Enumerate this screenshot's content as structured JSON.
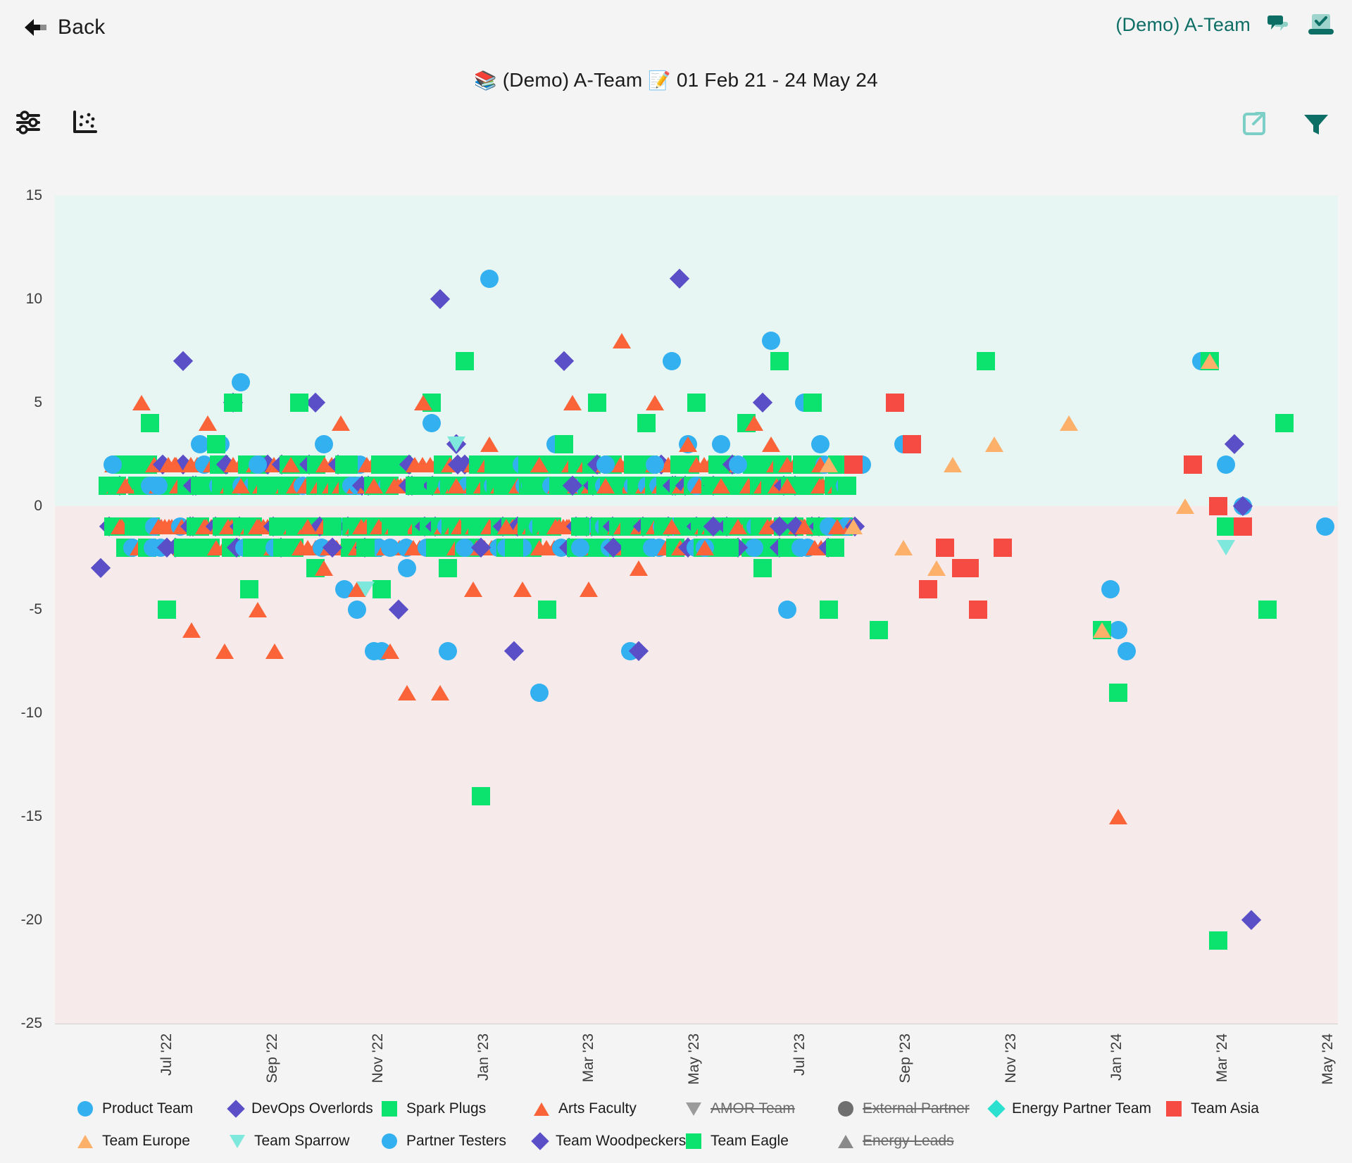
{
  "header": {
    "back_label": "Back",
    "back_icon": "arrow-left-icon",
    "account_label": "(Demo) A-Team",
    "chat_icon": "chat-bubbles-icon",
    "check_icon": "laptop-check-icon"
  },
  "page_title": {
    "books_emoji": "📚",
    "board_label": "(Demo) A-Team",
    "calendar_emoji": "📝",
    "date_range": "01 Feb 21 - 24 May 24"
  },
  "toolbar": {
    "settings_icon": "sliders-icon",
    "chart_icon": "scatter-plot-icon",
    "export_icon": "external-link-icon",
    "filter_icon": "funnel-filter-icon"
  },
  "colors": {
    "teal_dark": "#0d6e66",
    "teal_light": "#7ccfc6",
    "band_positive": "#e8f6f3",
    "band_negative": "#f7eaea",
    "page_bg": "#f4f4f4"
  },
  "chart_data": {
    "type": "scatter",
    "title": "(Demo) A-Team 01 Feb 21 - 24 May 24",
    "xlabel": "",
    "ylabel": "",
    "grid": false,
    "legend_position": "bottom",
    "ylim": [
      -25,
      15
    ],
    "yticks": [
      15,
      10,
      5,
      0,
      -5,
      -10,
      -15,
      -20,
      -25
    ],
    "xticks": [
      "Jul '22",
      "Sep '22",
      "Nov '22",
      "Jan '23",
      "Mar '23",
      "May '23",
      "Jul '23",
      "Sep '23",
      "Nov '23",
      "Jan '24",
      "Mar '24",
      "May '24"
    ],
    "xlim_months": [
      "2022-05-20",
      "2024-05-24"
    ],
    "bands": [
      {
        "from": 0,
        "to": 15,
        "color": "#e8f6f3"
      },
      {
        "from": -25,
        "to": 0,
        "color": "#f7eaea"
      }
    ],
    "series": [
      {
        "name": "Product Team",
        "marker": "circle",
        "color": "#32b0f0",
        "visible": true,
        "points": [
          [
            0.5,
            2
          ],
          [
            1.6,
            1
          ],
          [
            2.6,
            3
          ],
          [
            3.1,
            3
          ],
          [
            3.6,
            6
          ],
          [
            4.0,
            2
          ],
          [
            4.4,
            -2
          ],
          [
            4.6,
            -2
          ],
          [
            5.6,
            3
          ],
          [
            6.1,
            -4
          ],
          [
            6.4,
            -5
          ],
          [
            6.8,
            -7
          ],
          [
            7.0,
            -7
          ],
          [
            7.2,
            -2
          ],
          [
            7.6,
            -3
          ],
          [
            8.2,
            4
          ],
          [
            8.6,
            -7
          ],
          [
            9.0,
            -2
          ],
          [
            9.6,
            11
          ],
          [
            10.0,
            -2
          ],
          [
            10.4,
            -2
          ],
          [
            10.8,
            -9
          ],
          [
            11.2,
            3
          ],
          [
            11.8,
            -2
          ],
          [
            12.4,
            2
          ],
          [
            13.0,
            -7
          ],
          [
            13.6,
            2
          ],
          [
            14.0,
            7
          ],
          [
            14.4,
            3
          ],
          [
            14.8,
            -2
          ],
          [
            15.2,
            3
          ],
          [
            15.6,
            2
          ],
          [
            16.0,
            -2
          ],
          [
            16.4,
            8
          ],
          [
            16.8,
            -5
          ],
          [
            17.2,
            5
          ],
          [
            17.6,
            3
          ],
          [
            17.8,
            -1
          ],
          [
            18.6,
            2
          ],
          [
            19.6,
            3
          ],
          [
            24.6,
            -4
          ],
          [
            24.8,
            -6
          ],
          [
            25.0,
            -7
          ],
          [
            26.8,
            7
          ],
          [
            27.4,
            2
          ],
          [
            27.8,
            0
          ],
          [
            29.8,
            -1
          ]
        ]
      },
      {
        "name": "DevOps Overlords",
        "marker": "diamond",
        "color": "#5b4fc8",
        "visible": true,
        "points": [
          [
            0.2,
            -3
          ],
          [
            2.2,
            7
          ],
          [
            3.4,
            5
          ],
          [
            5.4,
            5
          ],
          [
            5.8,
            -2
          ],
          [
            7.4,
            -5
          ],
          [
            8.4,
            10
          ],
          [
            8.8,
            3
          ],
          [
            9.4,
            -2
          ],
          [
            10.2,
            -7
          ],
          [
            11.4,
            7
          ],
          [
            11.6,
            1
          ],
          [
            12.6,
            -2
          ],
          [
            13.2,
            -7
          ],
          [
            14.2,
            11
          ],
          [
            15.0,
            -1
          ],
          [
            15.6,
            -2
          ],
          [
            16.2,
            5
          ],
          [
            16.6,
            -1
          ],
          [
            17.0,
            -1
          ],
          [
            27.6,
            3
          ],
          [
            27.8,
            0
          ],
          [
            28.0,
            -20
          ]
        ]
      },
      {
        "name": "Spark Plugs",
        "marker": "square",
        "color": "#0ce36f",
        "visible": true,
        "points": [
          [
            0.6,
            1
          ],
          [
            1.0,
            -1
          ],
          [
            1.4,
            4
          ],
          [
            1.8,
            -5
          ],
          [
            2.2,
            -2
          ],
          [
            2.6,
            1
          ],
          [
            3.0,
            3
          ],
          [
            3.4,
            5
          ],
          [
            3.8,
            -4
          ],
          [
            4.2,
            1
          ],
          [
            4.6,
            -2
          ],
          [
            5.0,
            5
          ],
          [
            5.4,
            -3
          ],
          [
            5.8,
            -1
          ],
          [
            6.2,
            2
          ],
          [
            6.6,
            -2
          ],
          [
            7.0,
            -4
          ],
          [
            7.4,
            -1
          ],
          [
            7.8,
            1
          ],
          [
            8.2,
            5
          ],
          [
            8.6,
            -3
          ],
          [
            9.0,
            7
          ],
          [
            9.4,
            -14
          ],
          [
            9.8,
            2
          ],
          [
            10.2,
            -2
          ],
          [
            10.6,
            1
          ],
          [
            11.0,
            -5
          ],
          [
            11.4,
            3
          ],
          [
            11.8,
            -1
          ],
          [
            12.2,
            5
          ],
          [
            12.6,
            1
          ],
          [
            13.0,
            -2
          ],
          [
            13.4,
            4
          ],
          [
            13.8,
            -1
          ],
          [
            14.2,
            2
          ],
          [
            14.6,
            5
          ],
          [
            15.0,
            1
          ],
          [
            15.4,
            -2
          ],
          [
            15.8,
            4
          ],
          [
            16.2,
            -3
          ],
          [
            16.6,
            7
          ],
          [
            17.0,
            1
          ],
          [
            17.4,
            5
          ],
          [
            17.8,
            -5
          ],
          [
            18.2,
            2
          ],
          [
            19.0,
            -6
          ],
          [
            21.6,
            7
          ],
          [
            24.4,
            -6
          ],
          [
            24.8,
            -9
          ],
          [
            27.0,
            7
          ],
          [
            27.4,
            -1
          ],
          [
            28.4,
            -5
          ],
          [
            28.8,
            4
          ],
          [
            27.2,
            -21
          ]
        ]
      },
      {
        "name": "Arts Faculty",
        "marker": "triangle",
        "color": "#fa6438",
        "visible": true,
        "points": [
          [
            0.8,
            1
          ],
          [
            1.2,
            5
          ],
          [
            1.6,
            -1
          ],
          [
            2.0,
            2
          ],
          [
            2.4,
            -6
          ],
          [
            2.8,
            4
          ],
          [
            3.2,
            -7
          ],
          [
            3.6,
            1
          ],
          [
            4.0,
            -5
          ],
          [
            4.4,
            -7
          ],
          [
            4.8,
            2
          ],
          [
            5.2,
            -1
          ],
          [
            5.6,
            -3
          ],
          [
            6.0,
            4
          ],
          [
            6.4,
            -4
          ],
          [
            6.8,
            1
          ],
          [
            7.2,
            -7
          ],
          [
            7.6,
            -9
          ],
          [
            8.0,
            5
          ],
          [
            8.4,
            -9
          ],
          [
            8.8,
            1
          ],
          [
            9.2,
            -4
          ],
          [
            9.6,
            3
          ],
          [
            10.0,
            -1
          ],
          [
            10.4,
            -4
          ],
          [
            10.8,
            2
          ],
          [
            11.2,
            -1
          ],
          [
            11.6,
            5
          ],
          [
            12.0,
            -4
          ],
          [
            12.4,
            1
          ],
          [
            12.8,
            8
          ],
          [
            13.2,
            -3
          ],
          [
            13.6,
            5
          ],
          [
            14.0,
            -1
          ],
          [
            14.4,
            3
          ],
          [
            14.8,
            -2
          ],
          [
            15.2,
            1
          ],
          [
            15.6,
            -1
          ],
          [
            16.0,
            4
          ],
          [
            16.4,
            3
          ],
          [
            16.8,
            1
          ],
          [
            17.2,
            -1
          ],
          [
            17.6,
            2
          ],
          [
            18.0,
            -1
          ],
          [
            24.8,
            -15
          ]
        ]
      },
      {
        "name": "AMOR Team",
        "marker": "triangle-down",
        "color": "#9b9b9b",
        "visible": false,
        "points": []
      },
      {
        "name": "External Partner",
        "marker": "circle",
        "color": "#6f6f6f",
        "visible": false,
        "points": []
      },
      {
        "name": "Energy Partner Team",
        "marker": "diamond",
        "color": "#2ce0cf",
        "visible": true,
        "points": []
      },
      {
        "name": "Team Asia",
        "marker": "square",
        "color": "#f54b42",
        "visible": true,
        "points": [
          [
            18.4,
            2
          ],
          [
            19.4,
            5
          ],
          [
            19.8,
            3
          ],
          [
            20.2,
            -4
          ],
          [
            20.6,
            -2
          ],
          [
            21.0,
            -3
          ],
          [
            21.2,
            -3
          ],
          [
            21.4,
            -5
          ],
          [
            22.0,
            -2
          ],
          [
            26.6,
            2
          ],
          [
            27.2,
            0
          ],
          [
            27.8,
            -1
          ]
        ]
      },
      {
        "name": "Team Europe",
        "marker": "triangle",
        "color": "#fcb06a",
        "visible": true,
        "points": [
          [
            17.8,
            2
          ],
          [
            18.4,
            -1
          ],
          [
            19.6,
            -2
          ],
          [
            20.4,
            -3
          ],
          [
            20.8,
            2
          ],
          [
            21.8,
            3
          ],
          [
            23.6,
            4
          ],
          [
            26.4,
            0
          ],
          [
            27.0,
            7
          ],
          [
            24.4,
            -6
          ]
        ]
      },
      {
        "name": "Team Sparrow",
        "marker": "triangle-down",
        "color": "#7fe8dc",
        "visible": true,
        "points": [
          [
            6.6,
            -4
          ],
          [
            8.8,
            3
          ],
          [
            27.4,
            -2
          ]
        ]
      },
      {
        "name": "Partner Testers",
        "marker": "circle",
        "color": "#32b0f0",
        "visible": true,
        "points": []
      },
      {
        "name": "Team Woodpeckers",
        "marker": "diamond",
        "color": "#5b4fc8",
        "visible": true,
        "points": []
      },
      {
        "name": "Team Eagle",
        "marker": "square",
        "color": "#0ce36f",
        "visible": true,
        "points": []
      },
      {
        "name": "Energy Leads",
        "marker": "triangle",
        "color": "#8a8a8a",
        "visible": false,
        "points": []
      }
    ],
    "dense_clusters": {
      "note": "High-density bands of overlapping markers along y = 1, 2, -1, -2",
      "rows": [
        {
          "y": 1,
          "x_from": 0.4,
          "x_to": 18.3,
          "density": "very-high"
        },
        {
          "y": 2,
          "x_from": 0.5,
          "x_to": 18.2,
          "density": "high"
        },
        {
          "y": -1,
          "x_from": 0.4,
          "x_to": 18.5,
          "density": "very-high"
        },
        {
          "y": -2,
          "x_from": 0.8,
          "x_to": 18.0,
          "density": "high"
        }
      ]
    }
  },
  "legend": {
    "items": [
      {
        "label": "Product Team",
        "marker": "circle",
        "color": "#32b0f0",
        "enabled": true
      },
      {
        "label": "DevOps Overlords",
        "marker": "diamond",
        "color": "#5b4fc8",
        "enabled": true
      },
      {
        "label": "Spark Plugs",
        "marker": "square",
        "color": "#0ce36f",
        "enabled": true
      },
      {
        "label": "Arts Faculty",
        "marker": "triangle",
        "color": "#fa6438",
        "enabled": true
      },
      {
        "label": "AMOR Team",
        "marker": "triangle-down",
        "color": "#9b9b9b",
        "enabled": false
      },
      {
        "label": "External Partner",
        "marker": "circle",
        "color": "#6f6f6f",
        "enabled": false
      },
      {
        "label": "Energy Partner Team",
        "marker": "diamond",
        "color": "#2ce0cf",
        "enabled": true
      },
      {
        "label": "Team Asia",
        "marker": "square",
        "color": "#f54b42",
        "enabled": true
      },
      {
        "label": "Team Europe",
        "marker": "triangle",
        "color": "#fcb06a",
        "enabled": true
      },
      {
        "label": "Team Sparrow",
        "marker": "triangle-down",
        "color": "#7fe8dc",
        "enabled": true
      },
      {
        "label": "Partner Testers",
        "marker": "circle",
        "color": "#32b0f0",
        "enabled": true
      },
      {
        "label": "Team Woodpeckers",
        "marker": "diamond",
        "color": "#5b4fc8",
        "enabled": true
      },
      {
        "label": "Team Eagle",
        "marker": "square",
        "color": "#0ce36f",
        "enabled": true
      },
      {
        "label": "Energy Leads",
        "marker": "triangle",
        "color": "#8a8a8a",
        "enabled": false
      }
    ]
  }
}
